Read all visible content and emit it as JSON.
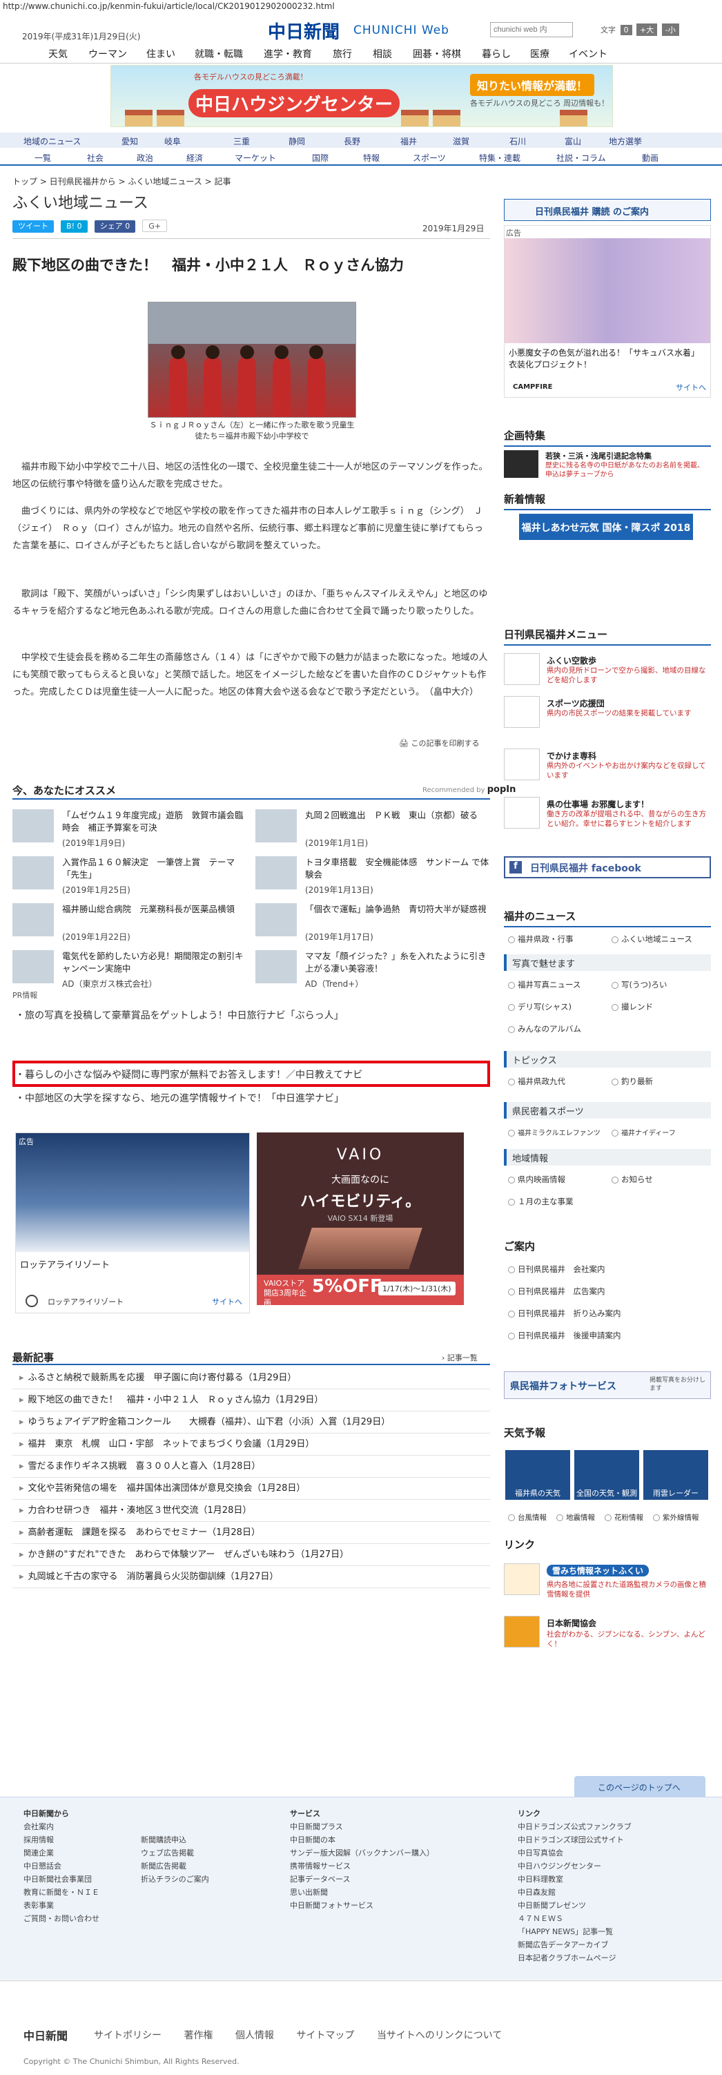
{
  "url": "http://www.chunichi.co.jp/kenmin-fukui/article/local/CK2019012902000232.html",
  "header": {
    "date": "2019年(平成31年)1月29日(火)",
    "logo": "中日新聞",
    "logo_sub": "CHUNICHI Web",
    "search_placeholder": "chunichi web 内",
    "font_size_label": "文字",
    "font_btn_0": "0",
    "font_btn_plus": "+大",
    "font_btn_minus": "-小",
    "categories": [
      "天気",
      "ウーマン",
      "住まい",
      "就職・転職",
      "進学・教育",
      "旅行",
      "相談",
      "囲碁・将棋",
      "暮らし",
      "医療",
      "イベント"
    ]
  },
  "banner": {
    "small": "各モデルハウスの見どころ満載！",
    "title": "中日ハウジングセンター",
    "right": "知りたい情報が満載！",
    "right_sub": "各モデルハウスの見どころ 周辺情報も！"
  },
  "regional_nav": {
    "row1": [
      "地域のニュース",
      "愛知",
      "岐阜",
      "三重",
      "静岡",
      "長野",
      "福井",
      "滋賀",
      "石川",
      "富山",
      "地方選挙"
    ],
    "row2": [
      "一覧",
      "社会",
      "政治",
      "経済",
      "マーケット",
      "国際",
      "特報",
      "スポーツ",
      "特集・連載",
      "社説・コラム",
      "動画"
    ]
  },
  "breadcrumb": "トップ > 日刊県民福井から > ふくい地域ニュース > 記事",
  "section_title": "ふくい地域ニュース",
  "share": {
    "tweet": "ツイート",
    "hatena": "B! 0",
    "facebook": "シェア 0",
    "gplus": "G+"
  },
  "article": {
    "date": "2019年1月29日",
    "headline": "殿下地区の曲できた！　福井・小中２１人　Ｒｏｙさん協力",
    "caption": "ＳｉｎｇＪＲｏｙさん（左）と一緒に作った歌を歌う児童生徒たち＝福井市殿下幼小中学校で",
    "paragraphs": [
      "福井市殿下幼小中学校で二十八日、地区の活性化の一環で、全校児童生徒二十一人が地区のテーマソングを作った。地区の伝統行事や特徴を盛り込んだ歌を完成させた。",
      "曲づくりには、県内外の学校などで地区や学校の歌を作ってきた福井市の日本人レゲエ歌手ｓｉｎｇ（シング）　Ｊ（ジェイ）　Ｒｏｙ（ロイ）さんが協力。地元の自然や名所、伝統行事、郷土料理など事前に児童生徒に挙げてもらった言葉を基に、ロイさんが子どもたちと話し合いながら歌詞を整えていった。",
      "歌詞は「殿下、笑顔がいっぱいさ」「シシ肉果ずしはおいしいさ」のほか、「亜ちゃんスマイルええやん」と地区のゆるキャラを紹介するなど地元色あふれる歌が完成。ロイさんの用意した曲に合わせて全員で踊ったり歌ったりした。",
      "中学校で生徒会長を務める二年生の斎藤悠さん（１４）は「にぎやかで殿下の魅力が詰まった歌になった。地域の人にも笑顔で歌ってもらえると良いな」と笑顔で話した。地区をイメージした絵などを書いた自作のＣＤジャケットも作った。完成したＣＤは児童生徒一人一人に配った。地区の体育大会や送る会などで歌う予定だという。　（畠中大介）"
    ],
    "print_link": "この記事を印刷する"
  },
  "recommend": {
    "title": "今、あなたにオススメ",
    "powered": "Recommended by",
    "powered_brand": "popIn",
    "items": [
      {
        "title": "「ムゼウム１９年度完成」遊筋　敦賀市議会臨時会　補正予算案を可決",
        "date": "(2019年1月9日)"
      },
      {
        "title": "丸岡２回戦進出　ＰＫ戦　東山（京都）破る",
        "date": "(2019年1月1日)"
      },
      {
        "title": "入賞作品１６０解決定　一筆啓上賞　テーマ「先生」",
        "date": "(2019年1月25日)"
      },
      {
        "title": "トヨタ車搭載　安全機能体感　サンドーム で体験会",
        "date": "(2019年1月13日)"
      },
      {
        "title": "福井勝山総合病院　元業務科長が医薬品横領",
        "date": "(2019年1月22日)"
      },
      {
        "title": "「個衣で運転」論争過熱　青切符大半が疑惑視",
        "date": "(2019年1月17日)"
      },
      {
        "title": "電気代を節約したい方必見！期間限定の割引キャンペーン実施中",
        "date": "AD（東京ガス株式会社）"
      },
      {
        "title": "ママ友「顔イジった？」糸を入れたように引き上がる凄い美容液！",
        "date": "AD（Trend+）"
      }
    ]
  },
  "pr": {
    "label": "PR情報",
    "items": [
      "旅の写真を投稿して豪華賞品をゲットしよう！中日旅行ナビ「ぶらっ人」",
      "暮らしの小さな悩みや疑問に専門家が無料でお答えします！／中日教えてナビ",
      "中部地区の大学を探すなら、地元の進学情報サイトで！「中日進学ナビ」"
    ]
  },
  "ads": {
    "ad_label": "広告",
    "lotte_caption": "ロッテアライリゾート",
    "lotte_brand": "ロッテアライリゾート",
    "lotte_link": "サイトへ",
    "vaio_logo": "VAIO",
    "vaio_l1": "大画面なのに",
    "vaio_l2": "ハイモビリティ。",
    "vaio_l3": "VAIO SX14 新登場",
    "vaio_store": "VAIOストア開店3周年企画",
    "vaio_off": "5%OFF",
    "vaio_period": "1/17(木)～1/31(木)"
  },
  "latest": {
    "title": "最新記事",
    "more": "記事一覧",
    "items": [
      "ふるさと納税で競新馬を応援　甲子園に向け寄付募る（1月29日）",
      "殿下地区の曲できた！　福井・小中２１人　Ｒｏｙさん協力（1月29日）",
      "ゆうちょアイデア貯金箱コンクール　　大槻春（福井）、山下君（小浜）入賞（1月29日）",
      "福井　東京　札幌　山口・宇部　ネットでまちづくり会議（1月29日）",
      "雪だるま作りギネス挑戦　喜３００人と喜入（1月28日）",
      "文化や芸術発信の場を　福井国体出演団体が意見交換会（1月28日）",
      "力合わせ研つき　福井・湊地区３世代交流（1月28日）",
      "高齢者運転　課題を探る　あわらでセミナー（1月28日）",
      "かき餅の\"すだれ\"できた　あわらで体験ツアー　ぜんざいも味わう（1月27日）",
      "丸岡城と千古の家守る　消防署員ら火災防御訓練（1月27日）"
    ]
  },
  "sidebar": {
    "subscribe": "日刊県民福井 購読 のご案内",
    "ad_label": "広告",
    "ad_text": "小悪魔女子の色気が溢れ出る！「サキュバス水着」衣装化プロジェクト！",
    "ad_brand": "CAMPFIRE",
    "ad_link": "サイトへ",
    "feature_title": "企画特集",
    "feature_text": "若狭・三浜・浅尾引退記念特集",
    "feature_desc": "歴史に残る名寺の中日紙があなたのお名前を掲載、申込は夢チューブから",
    "newinfo_title": "新着情報",
    "newinfo_banner": "福井しあわせ元気 国体・障スポ 2018",
    "menu_title": "日刊県民福井メニュー",
    "menu": [
      {
        "title": "ふくい空散歩",
        "desc": "県内の見所ドローンで空から撮影、地域の目線などを紹介します"
      },
      {
        "title": "スポーツ応援団",
        "desc": "県内の市民スポーツの結果を掲載しています"
      },
      {
        "title": "でかけま専科",
        "desc": "県内外のイベントやお出かけ案内などを収録しています"
      },
      {
        "title": "県の仕事場 お邪魔します！",
        "desc": "働き方の改革が提唱される中、昔ながらの生き方とい紹介。幸せに暮らすヒントを紹介します"
      }
    ],
    "facebook": "日刊県民福井 facebook",
    "fukui_news": "福井のニュース",
    "fukui_links": [
      "福井県政・行事",
      "ふくい地域ニュース"
    ],
    "photo_head": "写真で魅せます",
    "photo_links": [
      "福井写真ニュース",
      "写(うつ)ろい",
      "デリ写(シャス)",
      "撮レンド",
      "みんなのアルバム"
    ],
    "topics_head": "トピックス",
    "topics_links": [
      "福井県政九代",
      "釣り最新"
    ],
    "sports_head": "県民密着スポーツ",
    "sports_links": [
      "福井ミラクルエレファンツ",
      "福井ナイディーフ"
    ],
    "area_head": "地域情報",
    "area_links": [
      "県内映画情報",
      "お知らせ",
      "１月の主な事業"
    ],
    "guide_title": "ご案内",
    "guide_links": [
      "日刊県民福井　会社案内",
      "日刊県民福井　広告案内",
      "日刊県民福井　折り込み案内",
      "日刊県民福井　後援申請案内"
    ],
    "photo_service": "県民福井フォトサービス",
    "photo_service_sub": "掲載写真をお分けします",
    "weather_title": "天気予報",
    "weather": [
      "福井県の天気",
      "全国の天気・観測",
      "雨雲レーダー"
    ],
    "weather_links": [
      "台風情報",
      "地震情報",
      "花粉情報",
      "紫外線情報"
    ],
    "link_title": "リンク",
    "link_items": [
      {
        "title": "雪みち情報ネットふくい",
        "desc": "県内各地に設置された道路監視カメラの画像と積雪情報を提供"
      },
      {
        "title": "日本新聞協会",
        "desc": "社会がわかる、ジブンになる、シンブン、よんどく！"
      }
    ]
  },
  "footer": {
    "to_top": "このページのトップへ",
    "col1_head": "中日新聞から",
    "col1": [
      "会社案内",
      "採用情報",
      "関連企業",
      "中日懇話会",
      "中日新聞社会事業団",
      "教育に新聞を・ＮＩＥ",
      "表彰事業",
      "ご質問・お問い合わせ"
    ],
    "col2": [
      "新聞購読申込",
      "ウェブ広告掲載",
      "新聞広告掲載",
      "折込チラシのご案内"
    ],
    "col3_head": "サービス",
    "col3": [
      "中日新聞プラス",
      "中日新聞の本",
      "サンデー版大図解（バックナンバー購入）",
      "携帯情報サービス",
      "記事データベース",
      "思い出新聞",
      "中日新聞フォトサービス"
    ],
    "col4_head": "リンク",
    "col4": [
      "中日ドラゴンズ公式ファンクラブ",
      "中日ドラゴンズ球団公式サイト",
      "中日写真協会",
      "中日ハウジングセンター",
      "中日料理教室",
      "中日森友館",
      "中日新聞プレゼンツ",
      "４７ＮＥＷＳ",
      "「HAPPY NEWS」記事一覧",
      "新聞広告データアーカイブ",
      "日本記者クラブホームページ"
    ],
    "bottom_logo": "中日新聞",
    "bottom_links": [
      "サイトポリシー",
      "著作権",
      "個人情報",
      "サイトマップ",
      "当サイトへのリンクについて"
    ],
    "copyright": "Copyright © The Chunichi Shimbun, All Rights Reserved."
  }
}
